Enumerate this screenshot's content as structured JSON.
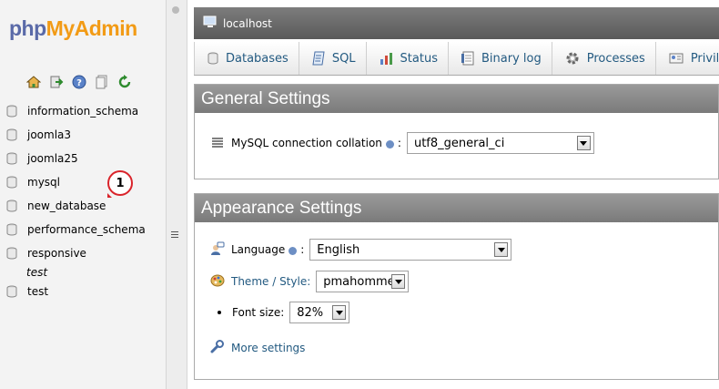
{
  "sidebar": {
    "logo_php": "php",
    "logo_myadmin": "MyAdmin",
    "quick_icons": [
      "home-icon",
      "logout-icon",
      "help-icon",
      "docs-icon",
      "reload-icon"
    ],
    "databases": [
      {
        "label": "information_schema"
      },
      {
        "label": "joomla3"
      },
      {
        "label": "joomla25"
      },
      {
        "label": "mysql"
      },
      {
        "label": "new_database"
      },
      {
        "label": "performance_schema"
      },
      {
        "label": "responsive"
      }
    ],
    "sub_item": "test",
    "last_item": "test",
    "annotation": "1"
  },
  "server_bar": {
    "name": "localhost"
  },
  "tabs": [
    {
      "label": "Databases",
      "icon": "database-icon"
    },
    {
      "label": "SQL",
      "icon": "sql-icon"
    },
    {
      "label": "Status",
      "icon": "status-icon"
    },
    {
      "label": "Binary log",
      "icon": "binary-log-icon"
    },
    {
      "label": "Processes",
      "icon": "processes-icon"
    },
    {
      "label": "Privile",
      "icon": "privileges-icon"
    }
  ],
  "general": {
    "title": "General Settings",
    "collation_label": "MySQL connection collation",
    "collation_value": "utf8_general_ci"
  },
  "appearance": {
    "title": "Appearance Settings",
    "language_label": "Language",
    "language_value": "English",
    "theme_label": "Theme / Style:",
    "theme_value": "pmahomme",
    "font_label": "Font size:",
    "font_value": "82%",
    "more_settings": "More settings"
  },
  "colors": {
    "link": "#235a81",
    "logo_php": "#5a6aa8",
    "logo_myadmin": "#f29b16",
    "annotation": "#d9232a"
  }
}
